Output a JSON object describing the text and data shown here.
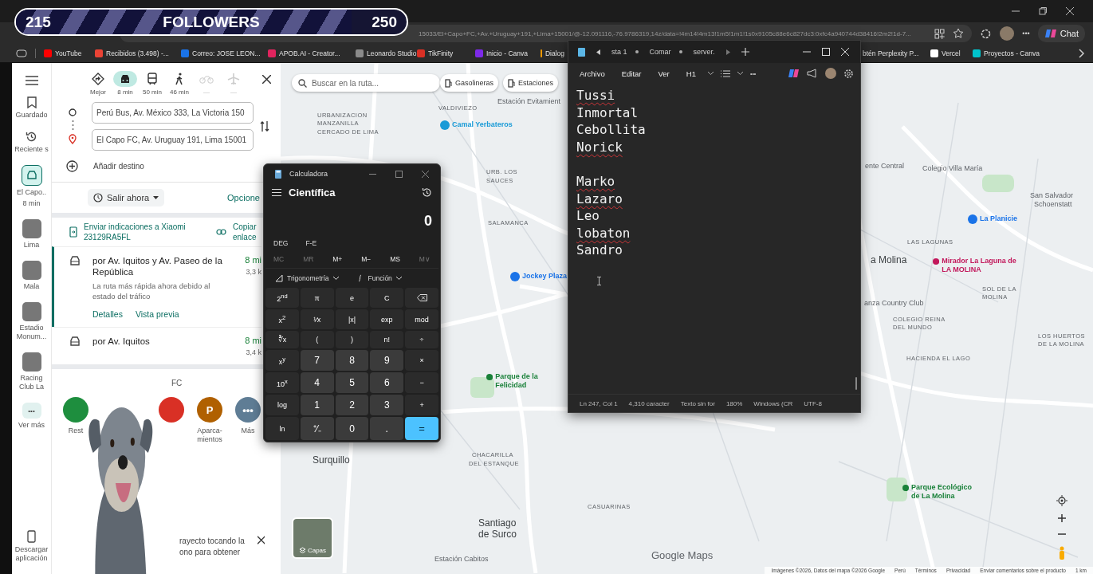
{
  "stream_overlay": {
    "start": "215",
    "label": "FOLLOWERS",
    "goal": "250",
    "level": 0.86
  },
  "browser": {
    "address": "15033/El+Capo+FC,+Av.+Uruguay+191,+Lima+15001/@-12.091116,-76.9786319,14z/data=!4m14!4m13!1m5!1m1!1s0x9105c88e6c827dc3:0xfc4a940744d38416!2m2!1d-7...",
    "chat": "Chat",
    "bookmarks": [
      {
        "label": "YouTube",
        "color": "#ff0000"
      },
      {
        "label": "Recibidos (3.498) -...",
        "color": "#ea4335"
      },
      {
        "label": "Correo: JOSE LEON...",
        "color": "#1a73e8"
      },
      {
        "label": "APOB.AI - Creator...",
        "color": "#e0245e"
      },
      {
        "label": "Leonardo Studio",
        "color": "#8a8a8a"
      },
      {
        "label": "TikFinity",
        "color": "#d93025"
      },
      {
        "label": "Inicio - Canva",
        "color": "#7d2ae8"
      },
      {
        "label": "Dialog",
        "color": "#f29900"
      },
      {
        "label": "btén Perplexity P..."
      },
      {
        "label": "Vercel",
        "color": "#ffffff"
      },
      {
        "label": "Proyectos - Canva",
        "color": "#00c4cc"
      }
    ]
  },
  "maps": {
    "rail": [
      {
        "kind": "menu"
      },
      {
        "kind": "saved",
        "label": "Guardado"
      },
      {
        "kind": "recent",
        "label": "Reciente s"
      },
      {
        "kind": "trip",
        "label": "El Capo..",
        "sublabel": "8 min",
        "selected": true
      },
      {
        "kind": "thumb",
        "label": "Lima"
      },
      {
        "kind": "thumb",
        "label": "Mala"
      },
      {
        "kind": "thumb",
        "label": "Estadio Monum..."
      },
      {
        "kind": "thumb",
        "label": "Racing Club La"
      },
      {
        "kind": "more",
        "label": "Ver más"
      },
      {
        "kind": "download",
        "label": "Descargar aplicación"
      }
    ],
    "modes": [
      {
        "kind": "best",
        "label": "Mejor",
        "selected": false,
        "disabled": false
      },
      {
        "kind": "car",
        "label": "8 min",
        "selected": true,
        "disabled": false
      },
      {
        "kind": "transit",
        "label": "50 min",
        "selected": false,
        "disabled": false
      },
      {
        "kind": "walk",
        "label": "46 min",
        "selected": false,
        "disabled": false
      },
      {
        "kind": "bike",
        "label": "—",
        "selected": false,
        "disabled": true
      },
      {
        "kind": "plane",
        "label": "—",
        "selected": false,
        "disabled": true
      }
    ],
    "origin": "Perú Bus, Av. México 333, La Victoria 150",
    "destination": "El Capo FC, Av. Uruguay 191, Lima 15001",
    "add_destination": "Añadir destino",
    "depart": "Salir ahora",
    "options": "Opcione",
    "send": "Enviar indicaciones a Xiaomi 23129RA5FL",
    "copy": "Copiar enlace",
    "routes": [
      {
        "name": "por Av. Iquitos y Av. Paseo de la República",
        "time": "8 mi",
        "distance": "3,3 k",
        "note": "La ruta más rápida ahora debido al estado del tráfico",
        "links": [
          "Detalles",
          "Vista previa"
        ],
        "selected": true
      },
      {
        "name": "por Av. Iquitos",
        "time": "8 mi",
        "distance": "3,4 k",
        "selected": false
      }
    ],
    "nearby_title": "FC",
    "categories": [
      {
        "label": "Rest",
        "color": "#1e8e3e"
      },
      {
        "color": "#d93025"
      },
      {
        "label": "Aparca- mientos",
        "icon": "P",
        "color": "#b06000"
      },
      {
        "label": "Más",
        "icon": "•••",
        "color": "#5f7d95"
      }
    ],
    "tip": "rayecto tocando la ono para obtener",
    "search_placeholder": "Buscar en la ruta...",
    "chips": [
      "Gasolineras",
      "Estaciones"
    ],
    "labels": [
      {
        "text": "URBANIZACION",
        "kind": "area"
      },
      {
        "text": "MANZANILLA",
        "kind": "area"
      },
      {
        "text": "CERCADO DE LIMA",
        "kind": "area"
      },
      {
        "text": "VALDIVIEZO",
        "kind": "area"
      },
      {
        "text": "Estación Evitamient",
        "kind": "transit"
      },
      {
        "text": "Camal Yerbateros",
        "kind": "poi",
        "color": "#1a9bd7"
      },
      {
        "text": "URB. LOS",
        "kind": "area"
      },
      {
        "text": "SAUCES",
        "kind": "area"
      },
      {
        "text": "SALAMANCA",
        "kind": "area"
      },
      {
        "text": "Jockey Plaza",
        "kind": "poi",
        "color": "#1a73e8"
      },
      {
        "text": "Parque de la Felicidad",
        "kind": "poi",
        "color": "#188038"
      },
      {
        "text": "Surquillo",
        "kind": "district"
      },
      {
        "text": "CHACARILLA",
        "kind": "area"
      },
      {
        "text": "DEL ESTANQUE",
        "kind": "area"
      },
      {
        "text": "Santiago de Surco",
        "kind": "district"
      },
      {
        "text": "Estación Cabitos",
        "kind": "transit"
      },
      {
        "text": "CASUARINAS",
        "kind": "area"
      },
      {
        "text": "ente Central",
        "kind": "transit"
      },
      {
        "text": "Colegio Villa María",
        "kind": "transit"
      },
      {
        "text": "San Salvador",
        "kind": "transit"
      },
      {
        "text": "Schoenstatt",
        "kind": "transit"
      },
      {
        "text": "La Planicie",
        "kind": "poi",
        "color": "#1a73e8"
      },
      {
        "text": "LAS LAGUNAS",
        "kind": "area"
      },
      {
        "text": "a Molina",
        "kind": "district"
      },
      {
        "text": "Mirador La Laguna de LA MOLINA",
        "kind": "poi",
        "color": "#c2185b"
      },
      {
        "text": "SOL DE LA MOLINA",
        "kind": "area"
      },
      {
        "text": "anza Country Club",
        "kind": "transit"
      },
      {
        "text": "COLEGIO REINA DEL MUNDO",
        "kind": "area"
      },
      {
        "text": "LOS HUERTOS DE LA MOLINA",
        "kind": "area"
      },
      {
        "text": "HACIENDA EL LAGO",
        "kind": "area"
      },
      {
        "text": "Parque Ecológico de La Molina",
        "kind": "poi",
        "color": "#188038"
      }
    ],
    "layers": "Capas",
    "logo": "Google Maps",
    "attribution": [
      "Imágenes ©2026, Datos del mapa ©2026 Google",
      "Perú",
      "Términos",
      "Privacidad",
      "Enviar comentarios sobre el producto",
      "1 km"
    ]
  },
  "calculator": {
    "title": "Calculadora",
    "mode": "Científica",
    "display": "0",
    "settings": [
      "DEG",
      "F-E"
    ],
    "memory": [
      {
        "label": "MC",
        "disabled": true
      },
      {
        "label": "MR",
        "disabled": true
      },
      {
        "label": "M+",
        "disabled": false
      },
      {
        "label": "M−",
        "disabled": false
      },
      {
        "label": "MS",
        "disabled": false
      },
      {
        "label": "M∨",
        "disabled": true
      }
    ],
    "menus": [
      "Trigonometría",
      "Función"
    ],
    "keys": [
      {
        "label": "2$^{nd}$",
        "kind": "fn"
      },
      {
        "label": "π",
        "kind": "fn"
      },
      {
        "label": "e",
        "kind": "fn"
      },
      {
        "label": "C",
        "kind": "fn"
      },
      {
        "kind": "backspace"
      },
      {
        "label": "x$^{2}$",
        "kind": "fn"
      },
      {
        "label": "¹⁄x",
        "kind": "fn"
      },
      {
        "label": "|x|",
        "kind": "fn"
      },
      {
        "label": "exp",
        "kind": "fn"
      },
      {
        "label": "mod",
        "kind": "fn"
      },
      {
        "label": "∛x",
        "kind": "fn"
      },
      {
        "label": "(",
        "kind": "fn"
      },
      {
        "label": ")",
        "kind": "fn"
      },
      {
        "label": "n!",
        "kind": "fn"
      },
      {
        "label": "÷",
        "kind": "fn"
      },
      {
        "label": "x$^{y}$",
        "kind": "fn"
      },
      {
        "label": "7",
        "kind": "num"
      },
      {
        "label": "8",
        "kind": "num"
      },
      {
        "label": "9",
        "kind": "num"
      },
      {
        "label": "×",
        "kind": "fn"
      },
      {
        "label": "10$^{x}$",
        "kind": "fn"
      },
      {
        "label": "4",
        "kind": "num"
      },
      {
        "label": "5",
        "kind": "num"
      },
      {
        "label": "6",
        "kind": "num"
      },
      {
        "label": "−",
        "kind": "fn"
      },
      {
        "label": "log",
        "kind": "fn"
      },
      {
        "label": "1",
        "kind": "num"
      },
      {
        "label": "2",
        "kind": "num"
      },
      {
        "label": "3",
        "kind": "num"
      },
      {
        "label": "+",
        "kind": "fn"
      },
      {
        "label": "ln",
        "kind": "fn"
      },
      {
        "label": "⁺⁄₋",
        "kind": "num"
      },
      {
        "label": "0",
        "kind": "num"
      },
      {
        "label": ".",
        "kind": "num"
      },
      {
        "label": "=",
        "kind": "equals"
      }
    ]
  },
  "notepad": {
    "tabs": [
      {
        "label": "sta 1",
        "unsaved": true
      },
      {
        "label": "Comar",
        "unsaved": true
      },
      {
        "label": "server.",
        "unsaved": false
      }
    ],
    "menu": [
      "Archivo",
      "Editar",
      "Ver",
      "H1"
    ],
    "paragraphs": [
      [
        {
          "text": "Tussi",
          "misspelled": true
        },
        {
          "text": "Inmortal",
          "misspelled": false
        },
        {
          "text": "Cebollita",
          "misspelled": false
        },
        {
          "text": "Norick",
          "misspelled": true
        }
      ],
      [
        {
          "text": "Marko",
          "misspelled": true
        },
        {
          "text": "Lazaro",
          "misspelled": true
        },
        {
          "text": "Leo",
          "misspelled": false
        },
        {
          "text": "lobaton",
          "misspelled": true
        },
        {
          "text": "Sandro",
          "misspelled": false
        }
      ]
    ],
    "status": [
      "Ln 247, Col 1",
      "4,310 caracter",
      "Texto sin for",
      "180%",
      "Windows (CR",
      "UTF-8"
    ]
  }
}
